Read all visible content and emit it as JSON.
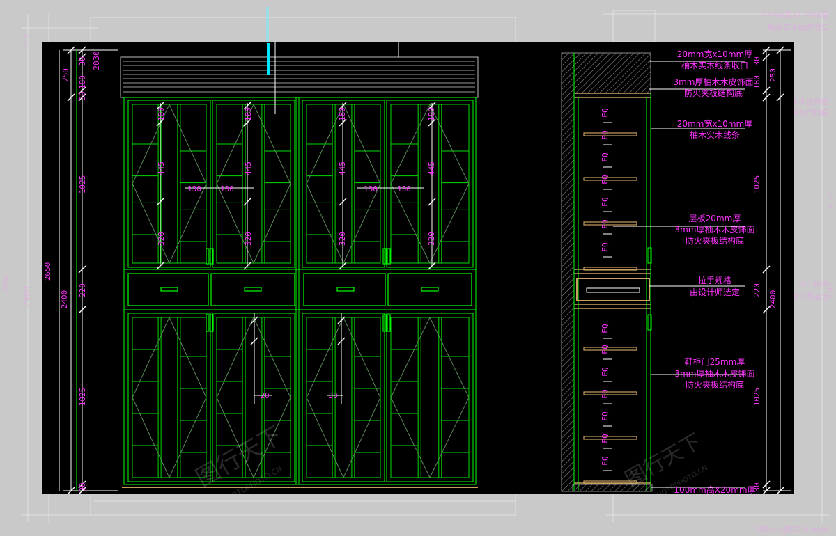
{
  "background_labels": [
    "20mm宽x10mm厚",
    "柚木实木线条收口",
    "3mm厚柚木木皮饰面",
    "防火夹板结构底",
    "拉手规格",
    "由设计师选定",
    "100mm高X20mm厚",
    "2650",
    "2400",
    "250",
    "1025",
    "220"
  ],
  "elevation": {
    "overall_height": "2650",
    "body_height": "2400",
    "left_dims": [
      "250",
      "30",
      "180",
      "30",
      "1025",
      "220",
      "1025",
      "30"
    ],
    "top_dims": [
      "30",
      "20"
    ],
    "door_dims": {
      "top_180": "180",
      "h445": "445",
      "h320": "320",
      "w130": "130",
      "w20": "20",
      "w30": "30"
    }
  },
  "section": {
    "right_dims": [
      "250",
      "30",
      "180",
      "1025",
      "220",
      "2400",
      "1025",
      "30"
    ],
    "eq_label": "EQ",
    "callouts": [
      {
        "id": "top-trim",
        "lines": [
          "20mm宽x10mm厚",
          "柚木实木线条收口"
        ]
      },
      {
        "id": "top-panel",
        "lines": [
          "3mm厚柚木木皮饰面",
          "防火夹板结构底"
        ]
      },
      {
        "id": "line-strip",
        "lines": [
          "20mm宽x10mm厚",
          "柚木实木线条"
        ]
      },
      {
        "id": "shelf",
        "lines": [
          "层板20mm厚",
          "3mm厚柚木木皮饰面",
          "防火夹板结构底"
        ]
      },
      {
        "id": "handle",
        "lines": [
          "拉手规格",
          "由设计师选定"
        ]
      },
      {
        "id": "door",
        "lines": [
          "鞋柜门25mm厚",
          "3mm厚柚木木皮饰面",
          "防火夹板结构底"
        ]
      },
      {
        "id": "base",
        "lines": [
          "100mm高X20mm厚"
        ]
      }
    ]
  },
  "watermark": {
    "brand": "图行天下",
    "url": "PHOTOPHOTO.CN"
  },
  "colors": {
    "paper": "#c9c9c9",
    "cad_background": "#000000",
    "cabinet_lines": "#00ff00",
    "dimension_text": "#ff33ff",
    "hatch": "#9a9a9a",
    "accent_cyan": "#00e5ff"
  }
}
